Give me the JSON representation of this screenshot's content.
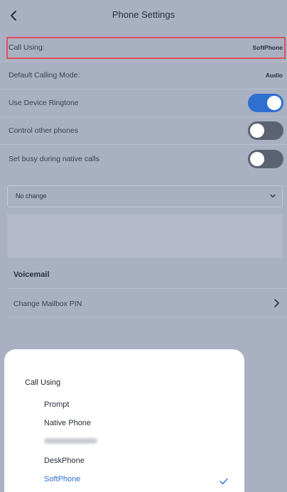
{
  "header": {
    "title": "Phone Settings",
    "back_icon": "chevron-left-icon"
  },
  "settings": {
    "call_using": {
      "label": "Call Using:",
      "value": "SoftPhone"
    },
    "default_calling_mode": {
      "label": "Default Calling Mode:",
      "value": "Audio"
    },
    "use_device_ringtone": {
      "label": "Use Device Ringtone",
      "on": true
    },
    "control_other_phones": {
      "label": "Control other phones",
      "on": false
    },
    "set_busy_native": {
      "label": "Set busy during native calls",
      "on": false
    },
    "busy_select": {
      "value": "No change"
    }
  },
  "voicemail": {
    "title": "Voicemail",
    "change_pin_label": "Change Mailbox PIN"
  },
  "sheet": {
    "title": "Call Using",
    "options": [
      "Prompt",
      "Native Phone",
      "DeskPhone",
      "SoftPhone"
    ],
    "selected": "SoftPhone"
  },
  "colors": {
    "background": "#a9b0c2",
    "accent": "#2f6fd0",
    "highlight_border": "#e2505a",
    "toggle_off": "#5b6272"
  }
}
